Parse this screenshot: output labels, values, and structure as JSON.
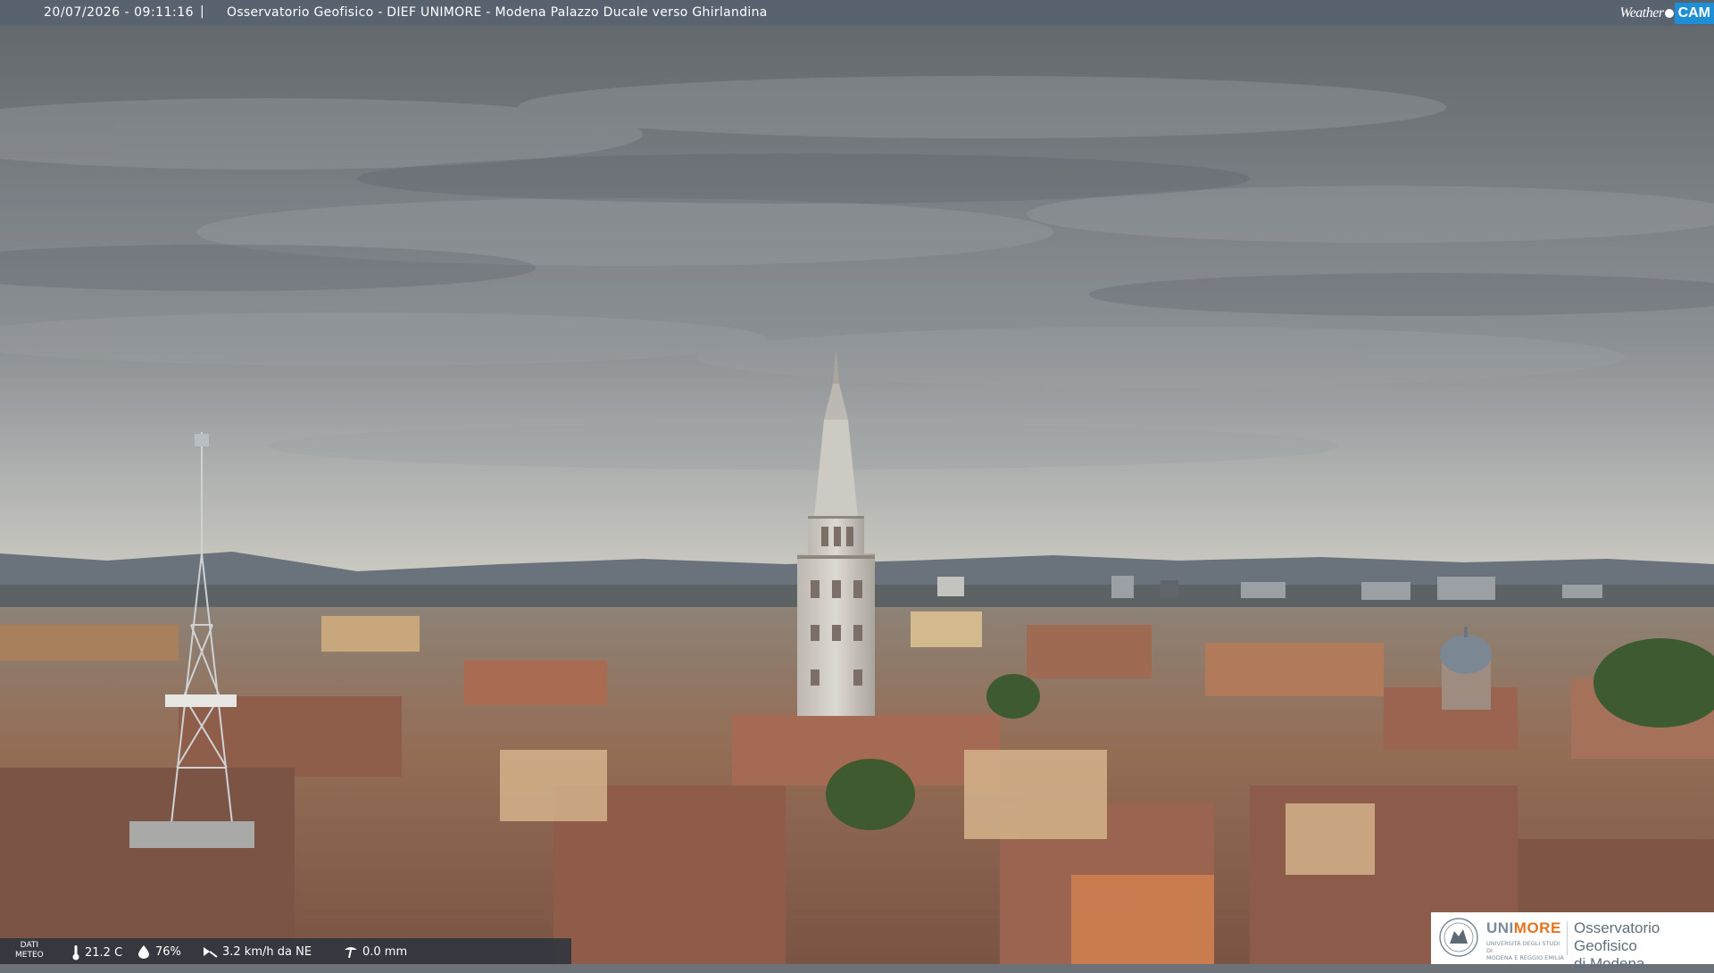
{
  "header": {
    "timestamp": "20/07/2026 - 09:11:16",
    "separator": "|",
    "camera_title": "Osservatorio Geofisico - DIEF UNIMORE - Modena Palazzo Ducale verso Ghirlandina"
  },
  "brand": {
    "weather_text": "Weather",
    "cam_text": "CAM",
    "cam_color": "#1e8fd6"
  },
  "meteo": {
    "label_line1": "DATI",
    "label_line2": "METEO",
    "temperature": "21.2 C",
    "humidity": "76%",
    "wind": "3.2 km/h da NE",
    "rain": "0.0 mm",
    "icons": [
      "thermometer-icon",
      "humidity-drop-icon",
      "wind-vane-icon",
      "rain-gauge-icon"
    ]
  },
  "logo": {
    "uni_part1": "UNI",
    "uni_part2": "MORE",
    "uni_sub_line1": "UNIVERSITÀ DEGLI STUDI DI",
    "uni_sub_line2": "MODENA E REGGIO EMILIA",
    "observatory_line1": "Osservatorio Geofisico",
    "observatory_line2": "di Modena",
    "accent_color": "#e3741f",
    "gray_color": "#7a8b99"
  }
}
